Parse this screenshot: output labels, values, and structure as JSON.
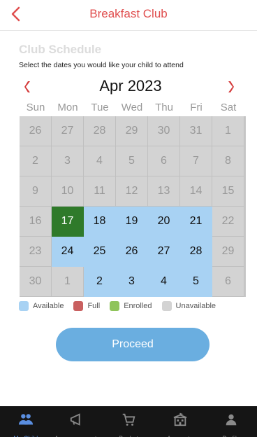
{
  "header": {
    "title": "Breakfast Club"
  },
  "schedule": {
    "title": "Club Schedule",
    "subtitle": "Select the dates you would like your child to attend"
  },
  "calendar": {
    "month": "Apr 2023",
    "weekdays": [
      "Sun",
      "Mon",
      "Tue",
      "Wed",
      "Thu",
      "Fri",
      "Sat"
    ],
    "days": [
      {
        "label": "26",
        "status": "unavailable"
      },
      {
        "label": "27",
        "status": "unavailable"
      },
      {
        "label": "28",
        "status": "unavailable"
      },
      {
        "label": "29",
        "status": "unavailable"
      },
      {
        "label": "30",
        "status": "unavailable"
      },
      {
        "label": "31",
        "status": "unavailable"
      },
      {
        "label": "1",
        "status": "unavailable"
      },
      {
        "label": "2",
        "status": "unavailable"
      },
      {
        "label": "3",
        "status": "unavailable"
      },
      {
        "label": "4",
        "status": "unavailable"
      },
      {
        "label": "5",
        "status": "unavailable"
      },
      {
        "label": "6",
        "status": "unavailable"
      },
      {
        "label": "7",
        "status": "unavailable"
      },
      {
        "label": "8",
        "status": "unavailable"
      },
      {
        "label": "9",
        "status": "unavailable"
      },
      {
        "label": "10",
        "status": "unavailable"
      },
      {
        "label": "11",
        "status": "unavailable"
      },
      {
        "label": "12",
        "status": "unavailable"
      },
      {
        "label": "13",
        "status": "unavailable"
      },
      {
        "label": "14",
        "status": "unavailable"
      },
      {
        "label": "15",
        "status": "unavailable"
      },
      {
        "label": "16",
        "status": "unavailable"
      },
      {
        "label": "17",
        "status": "enrolled"
      },
      {
        "label": "18",
        "status": "available"
      },
      {
        "label": "19",
        "status": "available"
      },
      {
        "label": "20",
        "status": "available"
      },
      {
        "label": "21",
        "status": "available"
      },
      {
        "label": "22",
        "status": "unavailable"
      },
      {
        "label": "23",
        "status": "unavailable"
      },
      {
        "label": "24",
        "status": "available"
      },
      {
        "label": "25",
        "status": "available"
      },
      {
        "label": "26",
        "status": "available"
      },
      {
        "label": "27",
        "status": "available"
      },
      {
        "label": "28",
        "status": "available"
      },
      {
        "label": "29",
        "status": "unavailable"
      },
      {
        "label": "30",
        "status": "unavailable"
      },
      {
        "label": "1",
        "status": "unavailable"
      },
      {
        "label": "2",
        "status": "available"
      },
      {
        "label": "3",
        "status": "available"
      },
      {
        "label": "4",
        "status": "available"
      },
      {
        "label": "5",
        "status": "available"
      },
      {
        "label": "6",
        "status": "unavailable"
      }
    ]
  },
  "legend": [
    {
      "label": "Available",
      "color": "#a8d2f3"
    },
    {
      "label": "Full",
      "color": "#c96060"
    },
    {
      "label": "Enrolled",
      "color": "#8fc45a"
    },
    {
      "label": "Unavailable",
      "color": "#d3d3d3"
    }
  ],
  "actions": {
    "proceed": "Proceed"
  },
  "tabbar": [
    {
      "label": "My Child",
      "icon": "people-icon",
      "active": true
    },
    {
      "label": "Announcements",
      "icon": "megaphone-icon",
      "active": false
    },
    {
      "label": "Basket",
      "icon": "cart-icon",
      "active": false
    },
    {
      "label": "Accounts",
      "icon": "building-icon",
      "active": false
    },
    {
      "label": "Profile",
      "icon": "person-icon",
      "active": false
    }
  ],
  "colors": {
    "accent": "#e04f4f",
    "available": "#a8d2f3",
    "enrolled": "#2f7a2a",
    "unavailable": "#d3d3d3",
    "proceed": "#6aaee0",
    "tab_active": "#5a8ee0"
  }
}
